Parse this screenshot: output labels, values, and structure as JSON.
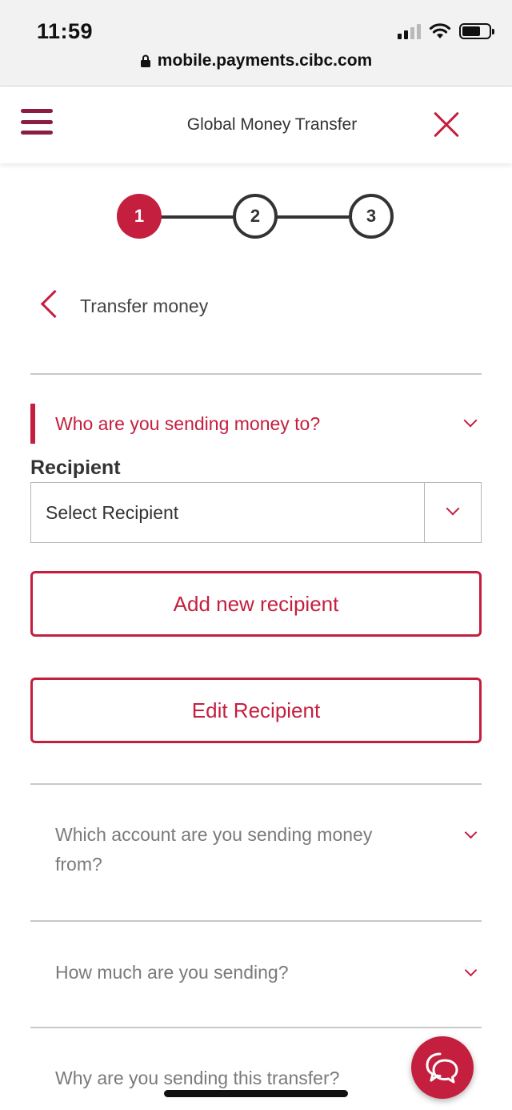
{
  "status_bar": {
    "time": "11:59"
  },
  "browser": {
    "url": "mobile.payments.cibc.com"
  },
  "header": {
    "title": "Global Money Transfer"
  },
  "stepper": {
    "steps": [
      "1",
      "2",
      "3"
    ],
    "current": 1
  },
  "back": {
    "label": "Transfer money"
  },
  "section_recipient": {
    "title": "Who are you sending money to?",
    "recipient_label": "Recipient",
    "select_value": "Select Recipient",
    "add_button": "Add new recipient",
    "edit_button": "Edit Recipient"
  },
  "section_account": {
    "title": "Which account are you sending money from?"
  },
  "section_amount": {
    "title": "How much are you sending?"
  },
  "section_reason": {
    "title": "Why are you sending this transfer?"
  },
  "colors": {
    "accent": "#c41f3e",
    "menu": "#8b1d41"
  },
  "icons": [
    "lock-icon",
    "hamburger-icon",
    "close-icon",
    "chevron-left-icon",
    "chevron-down-icon",
    "chat-icon"
  ]
}
